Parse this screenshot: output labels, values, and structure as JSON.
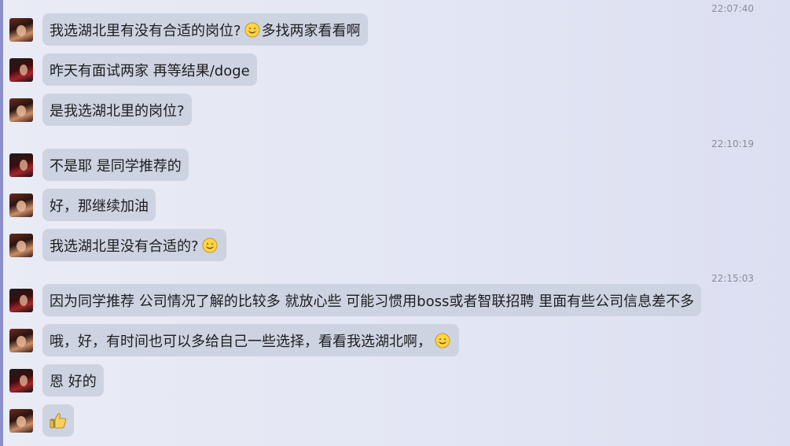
{
  "timestamps": [
    "22:07:40",
    "22:10:19",
    "22:15:03"
  ],
  "messages": [
    {
      "text_before": "我选湖北里有没有合适的岗位?",
      "emoji": "smiley",
      "text_after": "多找两家看看啊"
    },
    {
      "text": "昨天有面试两家 再等结果/doge"
    },
    {
      "text": "是我选湖北里的岗位?"
    },
    {
      "text": "不是耶 是同学推荐的"
    },
    {
      "text": "好，那继续加油"
    },
    {
      "text_before": "我选湖北里没有合适的?",
      "emoji": "smiley"
    },
    {
      "text": "因为同学推荐 公司情况了解的比较多 就放心些 可能习惯用boss或者智联招聘 里面有些公司信息差不多"
    },
    {
      "text_before": "哦，好，有时间也可以多给自己一些选择，看看我选湖北啊，",
      "emoji": "smiley"
    },
    {
      "text": "恩 好的"
    },
    {
      "emoji": "thumbs-up"
    }
  ],
  "colors": {
    "bubble": "#cdd3e0",
    "text": "#1d1d22",
    "timestamp": "#8a8d98",
    "left_strip": "#8b8fc9"
  }
}
